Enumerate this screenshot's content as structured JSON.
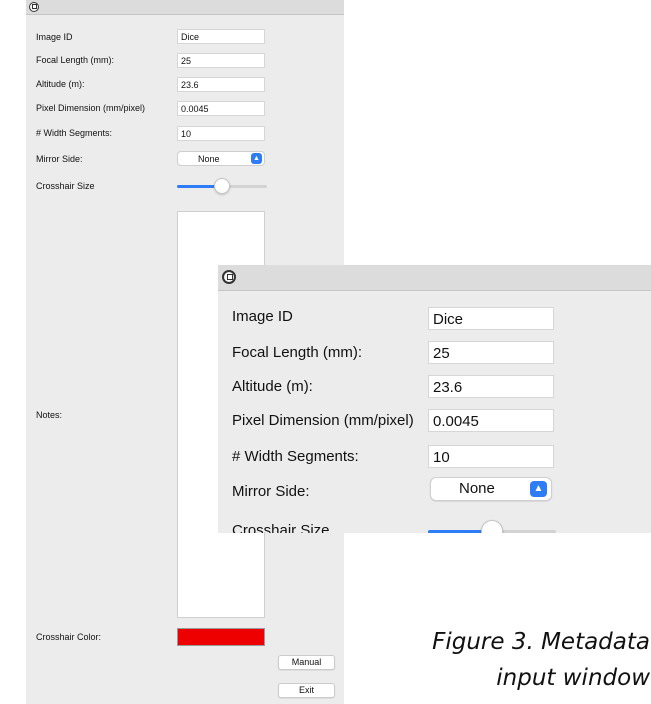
{
  "small_window": {
    "fields": [
      {
        "label": "Image ID",
        "value": "Dice"
      },
      {
        "label": "Focal Length (mm):",
        "value": "25"
      },
      {
        "label": "Altitude (m):",
        "value": "23.6"
      },
      {
        "label": "Pixel Dimension (mm/pixel)",
        "value": "0.0045"
      },
      {
        "label": "# Width Segments:",
        "value": "10"
      }
    ],
    "mirror_side": {
      "label": "Mirror Side:",
      "value": "None"
    },
    "crosshair_size": {
      "label": "Crosshair Size",
      "value_fraction": 0.5
    },
    "notes": {
      "label": "Notes:",
      "value": ""
    },
    "crosshair_color": {
      "label": "Crosshair Color:",
      "color": "#ee0000"
    },
    "buttons": {
      "manual": "Manual",
      "exit": "Exit"
    }
  },
  "large_window": {
    "fields": [
      {
        "label": "Image ID",
        "value": "Dice"
      },
      {
        "label": "Focal Length (mm):",
        "value": "25"
      },
      {
        "label": "Altitude (m):",
        "value": "23.6"
      },
      {
        "label": "Pixel Dimension (mm/pixel)",
        "value": "0.0045"
      },
      {
        "label": "# Width Segments:",
        "value": "10"
      }
    ],
    "mirror_side": {
      "label": "Mirror Side:",
      "value": "None"
    },
    "crosshair_size": {
      "label": "Crosshair Size",
      "value_fraction": 0.5
    }
  },
  "caption": {
    "line1": "Figure 3. Metadata",
    "line2": "input window"
  },
  "colors": {
    "accent": "#2f7df6",
    "window_bg": "#ececec"
  }
}
